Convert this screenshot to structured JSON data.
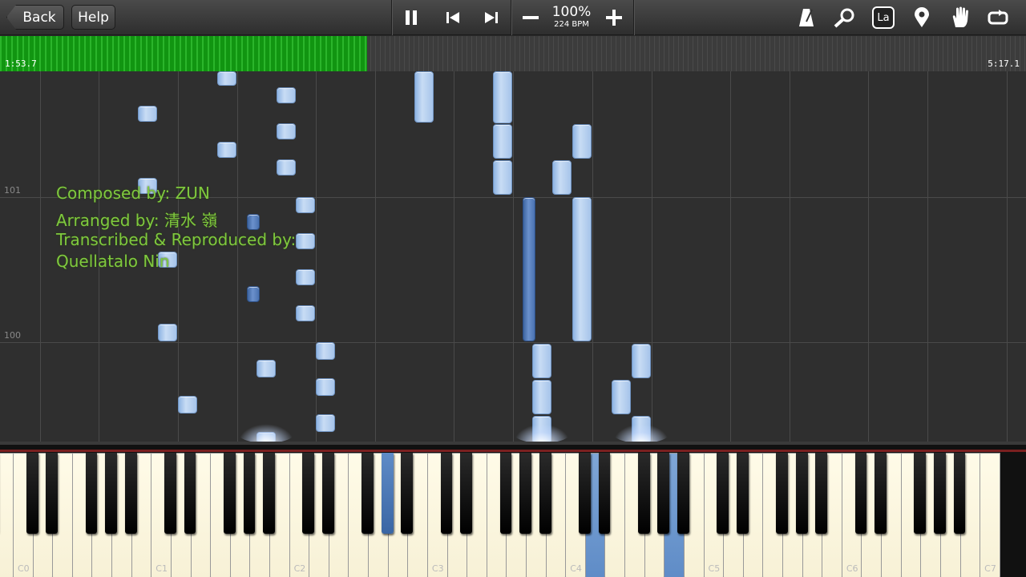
{
  "toolbar": {
    "back_label": "Back",
    "help_label": "Help",
    "zoom_percent": "100%",
    "tempo": "224 BPM",
    "icons": [
      "pause-icon",
      "previous-icon",
      "next-icon",
      "zoom-out-icon",
      "zoom-in-icon",
      "metronome-icon",
      "search-icon",
      "note-labels-icon",
      "marker-icon",
      "hand-icon",
      "loop-icon"
    ],
    "label_badge": "La"
  },
  "progress": {
    "elapsed": "1:53.7",
    "total": "5:17.1",
    "fraction": 0.358
  },
  "roll": {
    "measure_numbers": [
      "101",
      "100"
    ],
    "credits": [
      "Composed by: ZUN",
      "Arranged by: 清水 嶺",
      "Transcribed & Reproduced by:",
      "Quellatalo Nin"
    ]
  },
  "keyboard": {
    "octave_labels": [
      "C0",
      "C1",
      "C2",
      "C3",
      "C4",
      "C5",
      "C6",
      "C7"
    ],
    "pressed_keys": [
      "G#2",
      "D4",
      "A4"
    ]
  },
  "colors": {
    "note": "#a6c4ea",
    "note_dark": "#4a72b0",
    "progress": "#17a017",
    "credit_text": "#7fc93f"
  }
}
